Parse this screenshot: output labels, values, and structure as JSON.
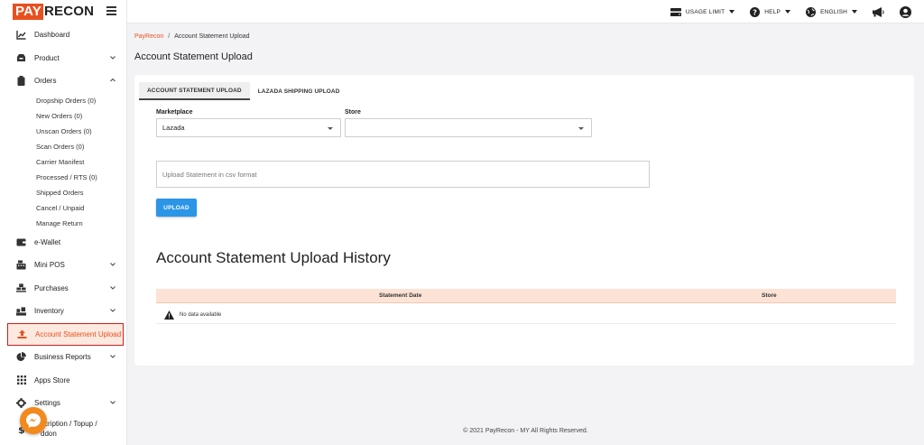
{
  "app": {
    "logo_pay": "PAY",
    "logo_recon": "RECON"
  },
  "sidebar": {
    "items": [
      {
        "id": "dashboard",
        "label": "Dashboard",
        "icon": "chart-line-icon"
      },
      {
        "id": "product",
        "label": "Product",
        "icon": "box-icon",
        "chevron": "down"
      },
      {
        "id": "orders",
        "label": "Orders",
        "icon": "clipboard-icon",
        "chevron": "up"
      },
      {
        "id": "ewallet",
        "label": "e-Wallet",
        "icon": "wallet-icon"
      },
      {
        "id": "minipos",
        "label": "Mini POS",
        "icon": "register-icon",
        "chevron": "down"
      },
      {
        "id": "purchases",
        "label": "Purchases",
        "icon": "pallet-icon",
        "chevron": "down"
      },
      {
        "id": "inventory",
        "label": "Inventory",
        "icon": "boxes-icon",
        "chevron": "down"
      },
      {
        "id": "account-statement-upload",
        "label": "Account Statement Upload",
        "icon": "upload-icon",
        "active": true
      },
      {
        "id": "business-reports",
        "label": "Business Reports",
        "icon": "pie-chart-icon",
        "chevron": "down"
      },
      {
        "id": "apps-store",
        "label": "Apps Store",
        "icon": "grid-icon"
      },
      {
        "id": "settings",
        "label": "Settings",
        "icon": "gear-icon",
        "chevron": "down"
      }
    ],
    "orders_sub": [
      "Dropship Orders (0)",
      "New Orders (0)",
      "Unscan Orders (0)",
      "Scan Orders (0)",
      "Carrier Manifest",
      "Processed / RTS (0)",
      "Shipped Orders",
      "Cancel / Unpaid",
      "Manage Return"
    ],
    "subscription_line1": "Subscription / Topup /",
    "subscription_line2": "Addon",
    "subscription_line1_visible": "scription / Topup /",
    "subscription_line2_visible": "ddon"
  },
  "topbar": {
    "usage_limit": "USAGE LIMIT",
    "help": "HELP",
    "language": "ENGLISH"
  },
  "breadcrumb": {
    "home": "PayRecon",
    "separator": "/",
    "current": "Account Statement Upload"
  },
  "page": {
    "title": "Account Statement Upload"
  },
  "tabs": [
    {
      "label": "ACCOUNT STATEMENT UPLOAD",
      "active": true
    },
    {
      "label": "LAZADA SHIPPING UPLOAD",
      "active": false
    }
  ],
  "form": {
    "marketplace_label": "Marketplace",
    "marketplace_value": "Lazada",
    "store_label": "Store",
    "store_value": "",
    "upload_placeholder": "Upload Statement in csv format",
    "upload_button": "UPLOAD"
  },
  "history": {
    "title": "Account Statement Upload History",
    "columns": [
      "Statement Date",
      "Store"
    ],
    "empty_text": "No data available"
  },
  "footer": {
    "text": "© 2021 PayRecon - MY All Rights Reserved."
  },
  "colors": {
    "brand": "#e8501f",
    "upload_button": "#2b95e8",
    "table_header": "#fde3d5",
    "active_border": "#d21e1e",
    "messenger": "#f28a1e"
  }
}
